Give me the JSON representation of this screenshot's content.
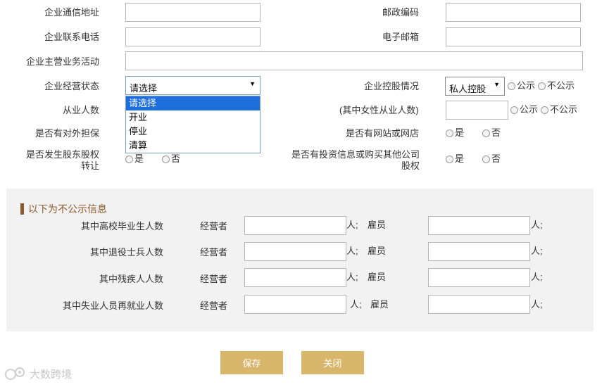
{
  "form": {
    "address_label": "企业通信地址",
    "postal_label": "邮政编码",
    "phone_label": "企业联系电话",
    "email_label": "电子邮箱",
    "business_label": "企业主营业务活动",
    "status_label": "企业经营状态",
    "status_selected": "请选择",
    "status_options": [
      "请选择",
      "开业",
      "停业",
      "清算"
    ],
    "holding_label": "企业控股情况",
    "holding_selected": "私人控股",
    "public_label": "公示",
    "nonpublic_label": "不公示",
    "employees_label": "从业人数",
    "female_label": "(其中女性从业人数)",
    "guarantee_label": "是否有对外担保",
    "website_label": "是否有网站或网店",
    "equity_label_line1": "是否发生股东股权",
    "equity_label_line2": "转让",
    "invest_label_line1": "是否有投资信息或购买其他公司",
    "invest_label_line2": "股权",
    "yes_label": "是",
    "no_label": "否"
  },
  "nonpublic_section": {
    "title": "以下为不公示信息",
    "rows": [
      {
        "label": "其中高校毕业生人数",
        "operator": "经营者",
        "unit1": "人;",
        "employee": "雇员",
        "unit2": "人;"
      },
      {
        "label": "其中退役士兵人数",
        "operator": "经营者",
        "unit1": "人;",
        "employee": "雇员",
        "unit2": "人;"
      },
      {
        "label": "其中残疾人人数",
        "operator": "经营者",
        "unit1": "人;",
        "employee": "雇员",
        "unit2": "人;"
      },
      {
        "label": "其中失业人员再就业人数",
        "operator": "经营者",
        "unit1": "人;",
        "employee": "雇员",
        "unit2": "人;"
      }
    ]
  },
  "buttons": {
    "save": "保存",
    "close": "关闭"
  },
  "watermark": "大数跨境",
  "colors": {
    "button_bg": "#d8b76c",
    "section_title": "#8b5a2b",
    "dropdown_highlight": "#1e6fdc",
    "panel_bg": "#f2f2f2"
  }
}
